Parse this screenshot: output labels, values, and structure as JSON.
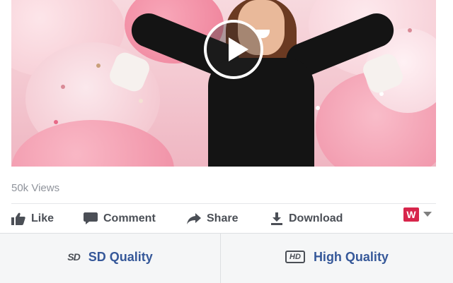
{
  "video": {
    "play_icon": "play-icon"
  },
  "stats": {
    "views": "50k Views"
  },
  "actions": {
    "like": {
      "label": "Like",
      "icon": "thumbs-up-icon"
    },
    "comment": {
      "label": "Comment",
      "icon": "comment-icon"
    },
    "share": {
      "label": "Share",
      "icon": "share-arrow-icon"
    },
    "download": {
      "label": "Download",
      "icon": "download-icon"
    },
    "brand_letter": "W"
  },
  "quality": {
    "sd": {
      "badge": "SD",
      "label": "SD Quality"
    },
    "hd": {
      "badge": "HD",
      "label": "High Quality"
    }
  },
  "colors": {
    "link": "#365899",
    "brand": "#d7254b",
    "muted": "#90949c"
  }
}
